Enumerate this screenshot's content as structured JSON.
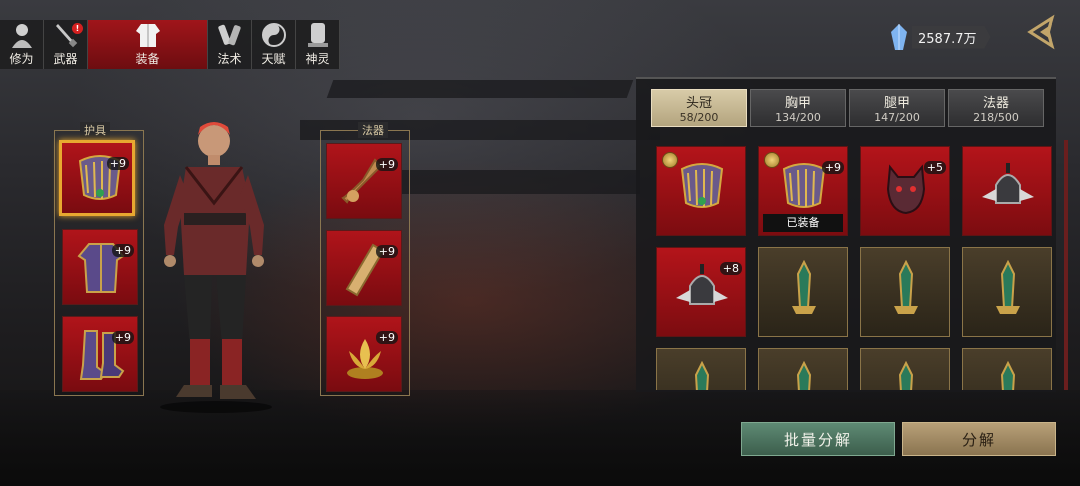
{
  "top_tabs": [
    {
      "label": "修为",
      "icon": "cultivation-icon",
      "active": false
    },
    {
      "label": "武器",
      "icon": "weapon-icon",
      "active": false,
      "badge": "!"
    },
    {
      "label": "装备",
      "icon": "equipment-icon",
      "active": true
    },
    {
      "label": "法术",
      "icon": "spell-icon",
      "active": false
    },
    {
      "label": "天赋",
      "icon": "talent-icon",
      "active": false
    },
    {
      "label": "神灵",
      "icon": "deity-icon",
      "active": false
    }
  ],
  "currency": {
    "icon": "crystal-icon",
    "amount": "2587.7万"
  },
  "back_icon": "back-arrow-icon",
  "armor_column": {
    "label": "护具",
    "slots": [
      {
        "item": "crown-icon",
        "level": "+9",
        "selected": true
      },
      {
        "item": "chest-armor-icon",
        "level": "+9",
        "selected": false
      },
      {
        "item": "boots-icon",
        "level": "+9",
        "selected": false
      }
    ]
  },
  "artifact_column": {
    "label": "法器",
    "slots": [
      {
        "item": "bell-icon",
        "level": "+9"
      },
      {
        "item": "scroll-icon",
        "level": "+9"
      },
      {
        "item": "lotus-icon",
        "level": "+9"
      }
    ]
  },
  "category_tabs": [
    {
      "name": "头冠",
      "count": "58/200",
      "active": true
    },
    {
      "name": "胸甲",
      "count": "134/200",
      "active": false
    },
    {
      "name": "腿甲",
      "count": "147/200",
      "active": false
    },
    {
      "name": "法器",
      "count": "218/500",
      "active": false
    }
  ],
  "inventory": [
    {
      "item": "crown-icon",
      "rarity": "red",
      "coin": true,
      "level": "",
      "equipped": false
    },
    {
      "item": "crown-icon",
      "rarity": "red",
      "coin": true,
      "level": "+9",
      "equipped": true
    },
    {
      "item": "demon-mask-icon",
      "rarity": "red",
      "coin": false,
      "level": "+5",
      "equipped": false
    },
    {
      "item": "winged-helmet-icon",
      "rarity": "red",
      "coin": false,
      "level": "",
      "equipped": false
    },
    {
      "item": "winged-helmet-icon",
      "rarity": "red",
      "coin": false,
      "level": "+8",
      "equipped": false
    },
    {
      "item": "jade-blade-icon",
      "rarity": "gold",
      "coin": false,
      "level": "",
      "equipped": false
    },
    {
      "item": "jade-blade-icon",
      "rarity": "gold",
      "coin": false,
      "level": "",
      "equipped": false
    },
    {
      "item": "jade-blade-icon",
      "rarity": "gold",
      "coin": false,
      "level": "",
      "equipped": false
    },
    {
      "item": "jade-blade-icon",
      "rarity": "gold",
      "coin": false,
      "level": "",
      "equipped": false
    },
    {
      "item": "jade-blade-icon",
      "rarity": "gold",
      "coin": false,
      "level": "",
      "equipped": false
    },
    {
      "item": "jade-blade-icon",
      "rarity": "gold",
      "coin": false,
      "level": "",
      "equipped": false
    },
    {
      "item": "jade-blade-icon",
      "rarity": "gold",
      "coin": false,
      "level": "",
      "equipped": false
    }
  ],
  "equipped_label": "已装备",
  "buttons": {
    "batch_decompose": "批量分解",
    "decompose": "分解"
  },
  "colors": {
    "slot_red": "#b0141a",
    "selected_border": "#e8a830",
    "batch_green": "#5e8a74",
    "decompose_tan": "#b8a078"
  }
}
